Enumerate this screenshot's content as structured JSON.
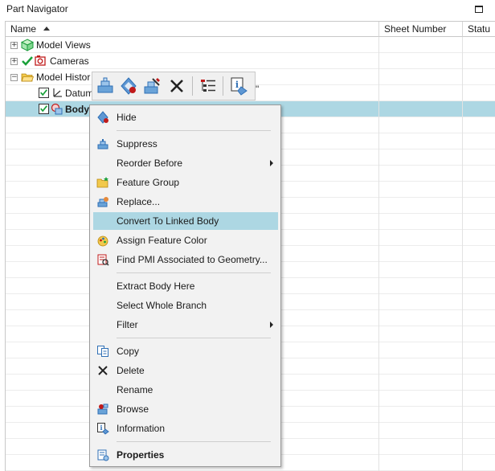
{
  "window": {
    "title": "Part Navigator"
  },
  "columns": {
    "name": "Name",
    "sheet_number": "Sheet Number",
    "status": "Statu"
  },
  "tree": {
    "model_views": "Model Views",
    "cameras": "Cameras",
    "model_history": "Model Histor",
    "datum": "Datum",
    "body": "Body"
  },
  "toolbar": {
    "more": "\""
  },
  "context_menu": {
    "hide": "Hide",
    "suppress": "Suppress",
    "reorder_before": "Reorder Before",
    "feature_group": "Feature Group",
    "replace": "Replace...",
    "convert_to_linked_body": "Convert To Linked Body",
    "assign_feature_color": "Assign Feature Color",
    "find_pmi": "Find PMI Associated to Geometry...",
    "extract_body_here": "Extract Body Here",
    "select_whole_branch": "Select Whole Branch",
    "filter": "Filter",
    "copy": "Copy",
    "delete": "Delete",
    "rename": "Rename",
    "browse": "Browse",
    "information": "Information",
    "properties": "Properties"
  },
  "colors": {
    "selection": "#add7e3",
    "accent_blue": "#2f6fb5",
    "check_green": "#1aa13a"
  }
}
